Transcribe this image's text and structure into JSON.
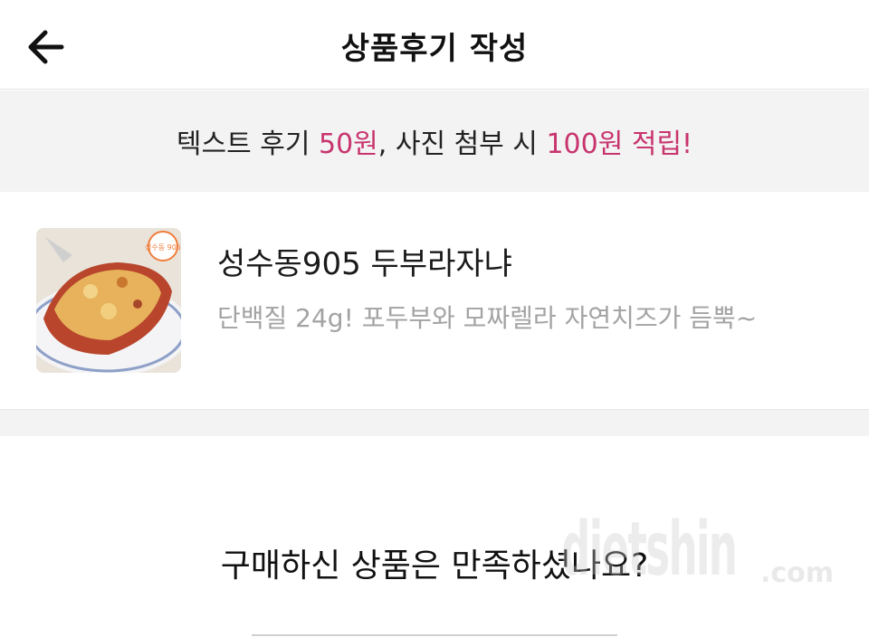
{
  "header": {
    "title": "상품후기 작성",
    "back_icon": "arrow-left-icon"
  },
  "banner": {
    "part1": "텍스트 후기 ",
    "amount1": "50원",
    "part2": ", 사진 첨부 시 ",
    "amount2": "100원 적립!",
    "accent_color": "#c8346e"
  },
  "product": {
    "name": "성수동905 두부라자냐",
    "description": "단백질 24g! 포두부와 모짜렐라 자연치즈가 듬뿍~",
    "thumbnail_icon": "lasagna-photo",
    "badge_text": "성수동 905"
  },
  "survey": {
    "question": "구매하신 상품은 만족하셨나요?"
  },
  "watermark": {
    "text": "dietshin",
    "suffix": ".com"
  }
}
